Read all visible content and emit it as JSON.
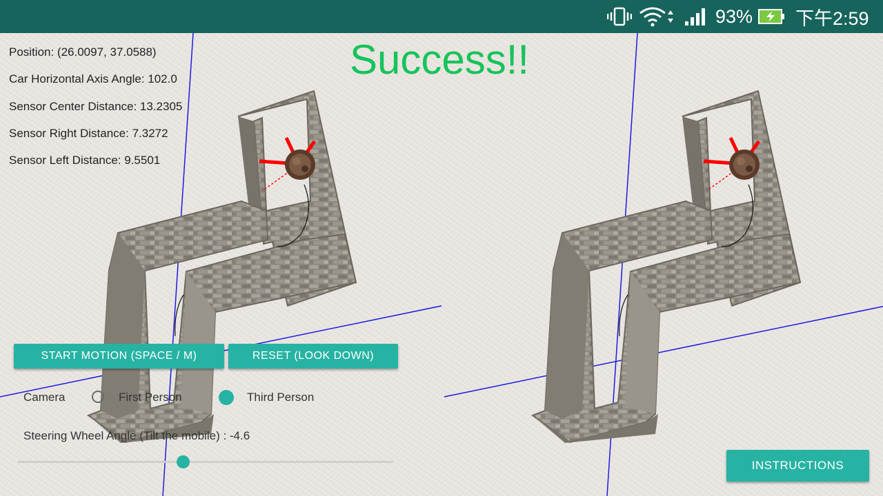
{
  "status_bar": {
    "battery": "93%",
    "time": "下午2:59",
    "icons": [
      "vibrate-icon",
      "wifi-icon",
      "signal-icon",
      "battery-charging-icon"
    ]
  },
  "info": {
    "position": "Position: (26.0097, 37.0588)",
    "car_angle": "Car Horizontal Axis Angle: 102.0",
    "sensor_center": "Sensor Center Distance: 13.2305",
    "sensor_right": "Sensor Right Distance: 7.3272",
    "sensor_left": "Sensor Left Distance: 9.5501"
  },
  "banner": "Success!!",
  "buttons": {
    "start": "START MOTION (SPACE / M)",
    "reset": "RESET (LOOK DOWN)",
    "instructions": "INSTRUCTIONS"
  },
  "camera": {
    "label": "Camera",
    "options": [
      "First Person",
      "Third Person"
    ],
    "selected": "Third Person"
  },
  "steering": {
    "label": "Steering Wheel Angle (Tilt the mobile) : -4.6",
    "slider_fraction": 0.44
  },
  "colors": {
    "accent": "#27b3a3",
    "status_bar": "#17645c",
    "success": "#16c35a",
    "axis_lines": "#1a1ae0",
    "sensor_rays": "#ff0000"
  }
}
